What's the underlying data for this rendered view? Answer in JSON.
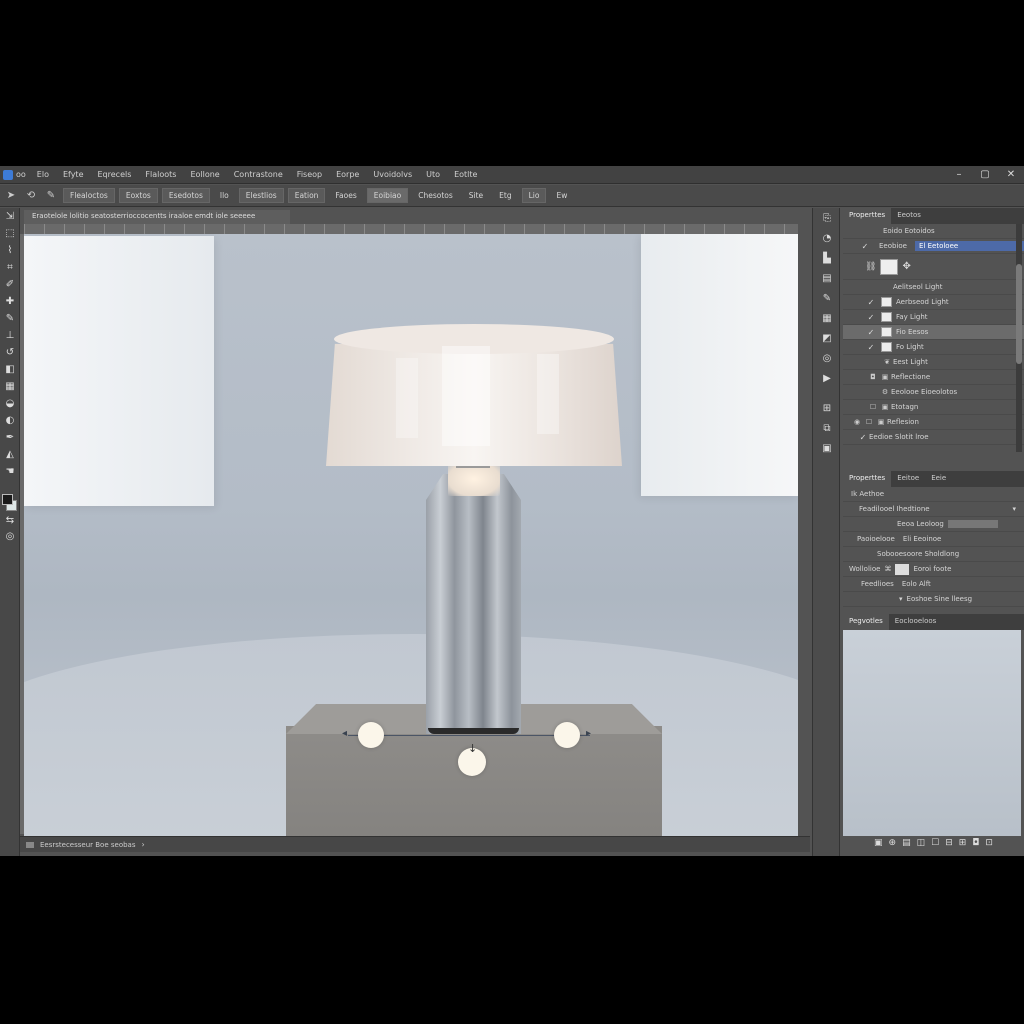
{
  "menubar": {
    "logo_label": "oo",
    "items": [
      "Elo",
      "Efyte",
      "Eqrecels",
      "Flaloots",
      "Eollone",
      "Contrastone",
      "Fiseop",
      "Eorpe",
      "Uvoidolvs",
      "Uto",
      "Eotlte"
    ],
    "window_controls": [
      "–",
      "▢",
      "✕"
    ]
  },
  "options_bar": {
    "items": [
      "Flealoctos",
      "Eoxtos",
      "Esedotos",
      "Ilo",
      "Elestlios",
      "Eation",
      "Faoes",
      "Eoibiao",
      "Chesotos",
      "Site",
      "Etg",
      "Lio",
      "Ew"
    ]
  },
  "document": {
    "tab_title": "Eraotelole lolitio seatosterrioccocentts iraaloe emdt iole seeeee",
    "status_text": "Eesrstecesseur Boe seobas"
  },
  "layers_panel": {
    "tabs": [
      "Properttes",
      "Eeotos"
    ],
    "header": "Eoido Eotoidos",
    "selected_row": {
      "label": "Eeobioe",
      "value": "El Eetoloee"
    },
    "group_label": "Aelitseol Light",
    "rows": [
      {
        "check": "✓",
        "label": "Aerbseod Light",
        "selected": false
      },
      {
        "check": "✓",
        "label": "Fay Light",
        "selected": false
      },
      {
        "check": "✓",
        "label": "Fio Eesos",
        "selected": true
      },
      {
        "check": "✓",
        "label": "Fo Light",
        "selected": false
      },
      {
        "check": "",
        "label": "Eest Light",
        "selected": false
      },
      {
        "check": "",
        "label": "Reflectione",
        "selected": false
      },
      {
        "check": "",
        "label": "Eeolooe Eioeolotos",
        "selected": false
      },
      {
        "check": "",
        "label": "Etotagn",
        "selected": false
      },
      {
        "check": "",
        "label": "Reflesion",
        "selected": false
      },
      {
        "check": "✓",
        "label": "Eedioe Slotit lroe",
        "selected": false
      }
    ]
  },
  "properties_panel": {
    "tabs": [
      "Properttes",
      "Eeitoe",
      "Eeie"
    ],
    "header": "Ik Aethoe",
    "rows": [
      {
        "label": "Feadilooel Ihedtione",
        "value": ""
      },
      {
        "label": "Eeoa Leoloog",
        "value": ""
      },
      {
        "label": "Paoioelooe",
        "value": "Eli Eeoinoe"
      },
      {
        "label": "Sobooesoore Sholdlong",
        "value": ""
      },
      {
        "label": "Wollolioe",
        "value": "Eoroi foote"
      },
      {
        "label": "Feedlioes",
        "value": "Eolo Alft"
      },
      {
        "label": "Eoshoe Sine lleesg",
        "value": ""
      }
    ]
  },
  "preview_panel": {
    "tabs": [
      "Pegvotles",
      "Eoclooeloos"
    ]
  },
  "bottom_icons": [
    "▣",
    "⊕",
    "▤",
    "◫",
    "☐",
    "⊟",
    "⊞",
    "◘",
    "⊡"
  ]
}
